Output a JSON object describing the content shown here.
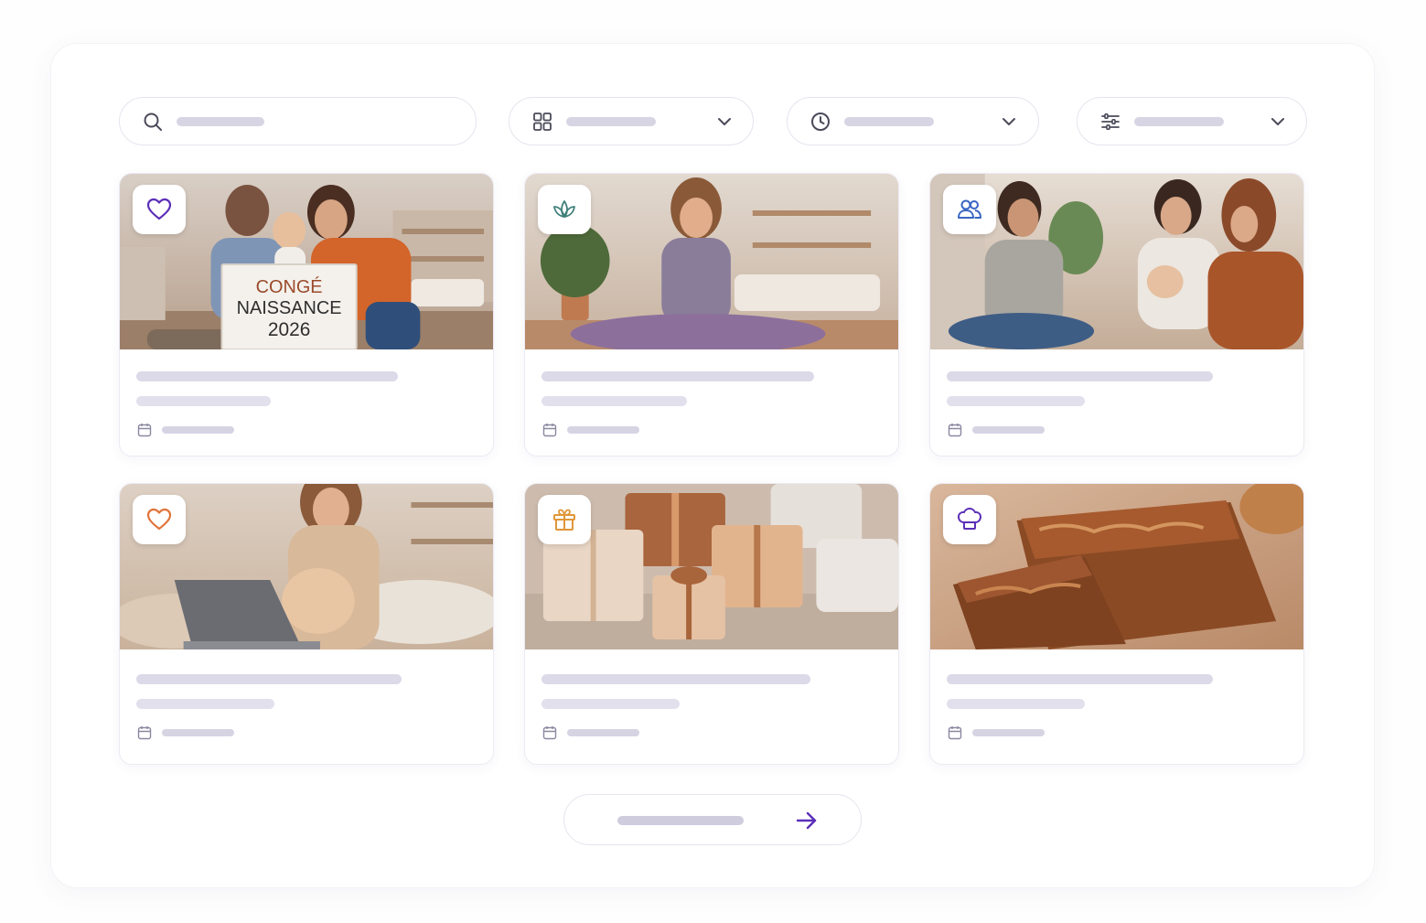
{
  "colors": {
    "accent": "#5b2fb8",
    "accent_warm": "#e0733a",
    "accent_teal": "#3f7f7a",
    "accent_blue": "#3a66c4",
    "skeleton": "#dcdae8"
  },
  "filters": [
    {
      "icon": "search-icon",
      "type": "search"
    },
    {
      "icon": "grid-icon",
      "type": "dropdown"
    },
    {
      "icon": "clock-icon",
      "type": "dropdown"
    },
    {
      "icon": "sliders-icon",
      "type": "dropdown"
    }
  ],
  "cards": [
    {
      "badge_icon": "heart-icon",
      "badge_color": "#5b2fb8",
      "image": "family with baby holding sign",
      "sign": {
        "line1": "CONGÉ",
        "line2": "NAISSANCE",
        "line3": "2026"
      }
    },
    {
      "badge_icon": "lotus-icon",
      "badge_color": "#3f7f7a",
      "image": "pregnant woman yoga"
    },
    {
      "badge_icon": "users-icon",
      "badge_color": "#3a66c4",
      "image": "group of mothers with baby"
    },
    {
      "badge_icon": "heart-icon",
      "badge_color": "#e0733a",
      "image": "pregnant woman with laptop"
    },
    {
      "badge_icon": "gift-icon",
      "badge_color": "#e0973a",
      "image": "wrapped gifts"
    },
    {
      "badge_icon": "chef-hat-icon",
      "badge_color": "#5b2fb8",
      "image": "baked loaf cake"
    }
  ],
  "more_button": {
    "icon": "arrow-right-icon"
  }
}
